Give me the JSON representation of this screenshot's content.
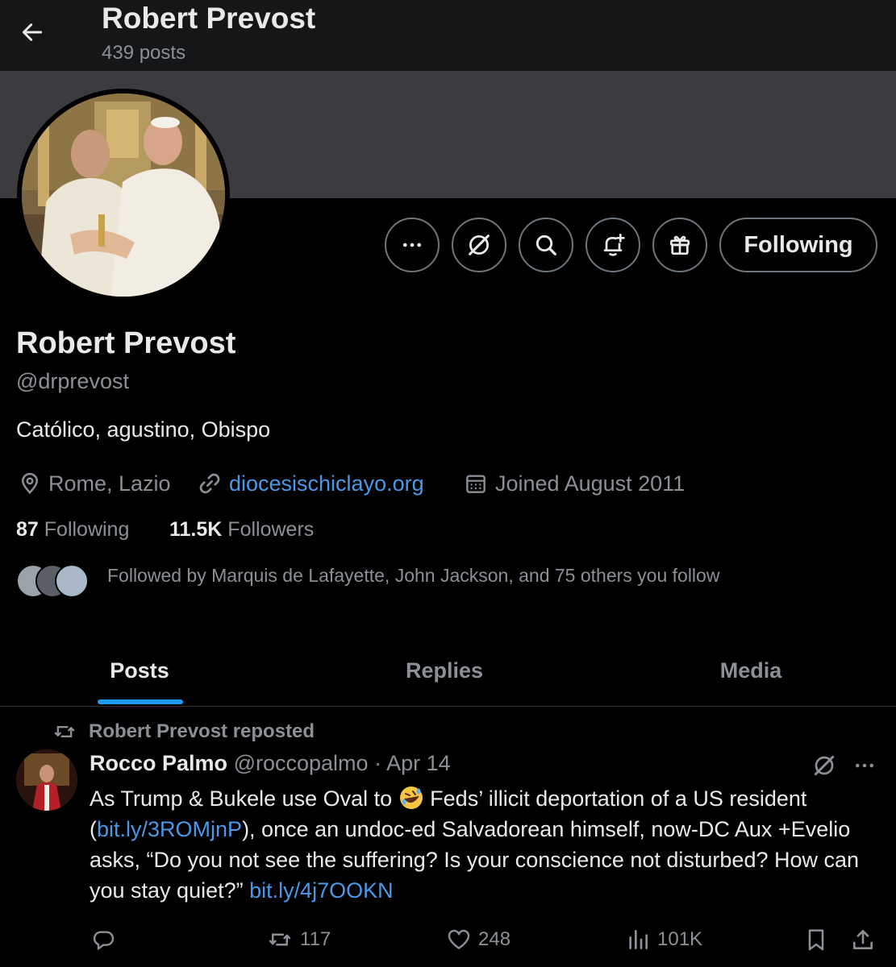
{
  "header": {
    "name": "Robert Prevost",
    "posts_count": "439 posts"
  },
  "actions": {
    "more_icon": "more-horizontal-icon",
    "grok_icon": "grok-icon",
    "search_icon": "search-icon",
    "notify_icon": "bell-plus-icon",
    "subscribe_icon": "gift-icon",
    "following_label": "Following"
  },
  "profile": {
    "name": "Robert Prevost",
    "handle": "@drprevost",
    "bio": "Católico, agustino, Obispo",
    "location": "Rome, Lazio",
    "website": "diocesischiclayo.org",
    "joined": "Joined August 2011",
    "following_count": "87",
    "following_label": "Following",
    "followers_count": "11.5K",
    "followers_label": "Followers",
    "followed_by": "Followed by Marquis de Lafayette, John Jackson, and 75 others you follow"
  },
  "tabs": [
    {
      "label": "Posts",
      "active": true
    },
    {
      "label": "Replies",
      "active": false
    },
    {
      "label": "Media",
      "active": false
    }
  ],
  "post": {
    "repost_text": "Robert Prevost reposted",
    "author": "Rocco Palmo",
    "handle": "@roccopalmo",
    "separator": "·",
    "date": "Apr 14",
    "body_1": "As Trump & Bukele use Oval to ",
    "emoji": "rolling-on-floor-laughing-emoji",
    "body_2": " Feds’ illicit deportation of a US resident (",
    "link_1": "bit.ly/3ROMjnP",
    "body_3": "), once an undoc-ed Salvadorean himself, now-DC Aux +Evelio asks, “Do you not see the suffering? Is your conscience not disturbed? How can you stay quiet?” ",
    "link_2": "bit.ly/4j7OOKN",
    "reposts": "117",
    "likes": "248",
    "views": "101K"
  },
  "colors": {
    "background": "#000000",
    "header_bg": "#151617",
    "banner": "#3a3c3f",
    "text": "#e7e9ea",
    "muted": "#8b9096",
    "link": "#4a99e9",
    "accent": "#1d9bf0"
  }
}
